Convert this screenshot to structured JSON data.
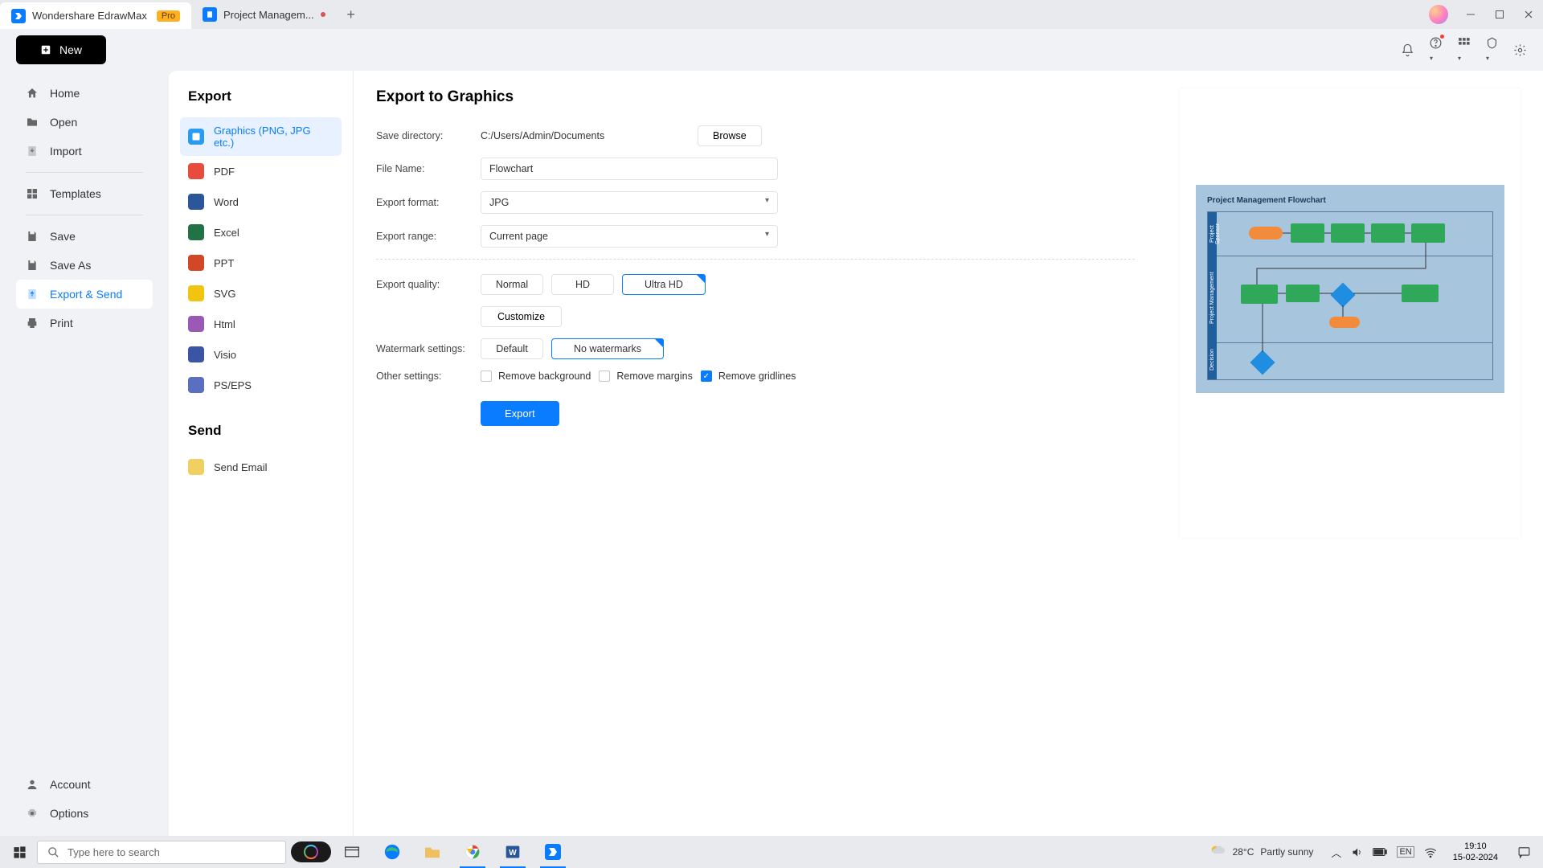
{
  "titlebar": {
    "app_tab": "Wondershare EdrawMax",
    "pro_badge": "Pro",
    "doc_tab": "Project Managem..."
  },
  "toolbar": {
    "new_label": "New"
  },
  "leftnav": {
    "home": "Home",
    "open": "Open",
    "import": "Import",
    "templates": "Templates",
    "save": "Save",
    "save_as": "Save As",
    "export_send": "Export & Send",
    "print": "Print",
    "account": "Account",
    "options": "Options"
  },
  "export_types": {
    "heading": "Export",
    "graphics": "Graphics (PNG, JPG etc.)",
    "pdf": "PDF",
    "word": "Word",
    "excel": "Excel",
    "ppt": "PPT",
    "svg": "SVG",
    "html": "Html",
    "visio": "Visio",
    "pseps": "PS/EPS",
    "send_heading": "Send",
    "send_email": "Send Email"
  },
  "form": {
    "heading": "Export to Graphics",
    "save_dir_label": "Save directory:",
    "save_dir_value": "C:/Users/Admin/Documents",
    "browse": "Browse",
    "filename_label": "File Name:",
    "filename_value": "Flowchart",
    "format_label": "Export format:",
    "format_value": "JPG",
    "range_label": "Export range:",
    "range_value": "Current page",
    "quality_label": "Export quality:",
    "quality_normal": "Normal",
    "quality_hd": "HD",
    "quality_ultra": "Ultra HD",
    "customize": "Customize",
    "watermark_label": "Watermark settings:",
    "watermark_default": "Default",
    "watermark_none": "No watermarks",
    "other_label": "Other settings:",
    "remove_bg": "Remove background",
    "remove_margins": "Remove margins",
    "remove_grid": "Remove gridlines",
    "export_btn": "Export"
  },
  "preview": {
    "title": "Project Management Flowchart",
    "lane1": "Project Sponsor",
    "lane2": "Project Management",
    "lane3": "Decision"
  },
  "taskbar": {
    "search_placeholder": "Type here to search",
    "weather_temp": "28°C",
    "weather_text": "Partly sunny",
    "time": "19:10",
    "date": "15-02-2024"
  }
}
